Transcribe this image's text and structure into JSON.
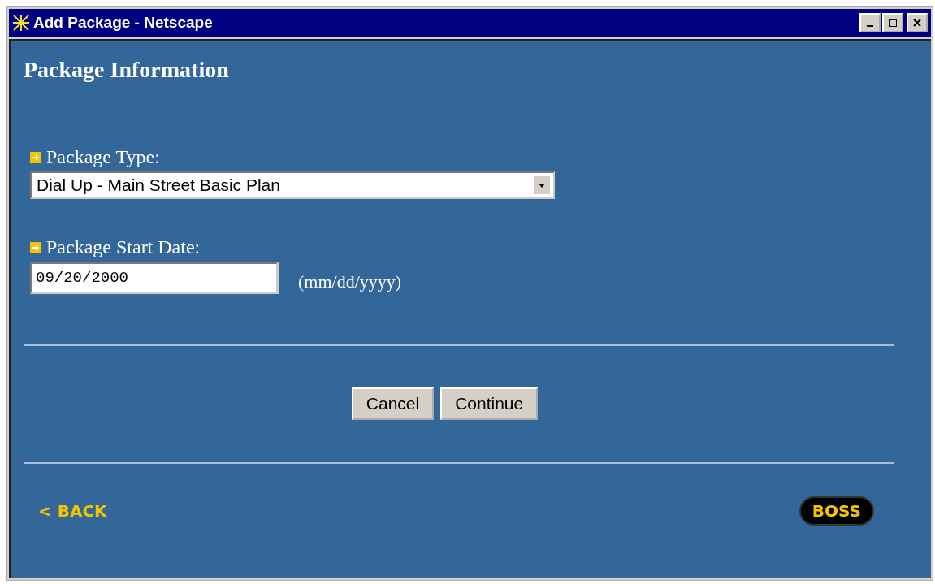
{
  "window": {
    "title": "Add Package - Netscape"
  },
  "heading": "Package Information",
  "fields": [
    {
      "kind": "select",
      "label": "Package Type:",
      "value": "Dial Up - Main Street Basic Plan"
    },
    {
      "kind": "text",
      "label": "Package Start Date:",
      "value": "09/20/2000",
      "hint": "(mm/dd/yyyy)"
    }
  ],
  "buttons": [
    "Cancel",
    "Continue"
  ],
  "back_link": "< BACK",
  "logo": "BOSS"
}
